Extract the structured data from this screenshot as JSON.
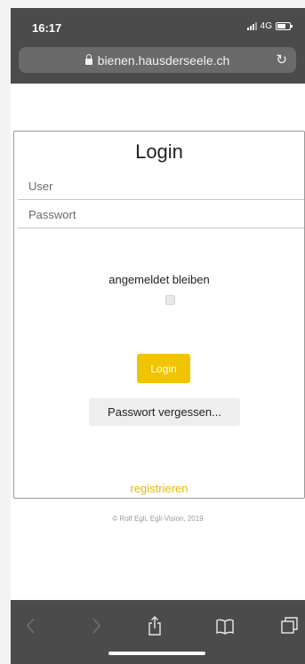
{
  "status_bar": {
    "time": "16:17",
    "network": "4G"
  },
  "browser": {
    "url": "bienen.hausderseele.ch"
  },
  "login": {
    "title": "Login",
    "user_placeholder": "User",
    "password_placeholder": "Passwort",
    "remember_label": "angemeldet bleiben",
    "remember_checked": false,
    "login_button": "Login",
    "forgot_button": "Passwort vergessen...",
    "register_link": "registrieren"
  },
  "footer": {
    "copyright": "© Rolf Egli, Egli-Vision, 2019"
  },
  "colors": {
    "accent": "#f0c400",
    "link": "#e8b800",
    "chrome": "#4b4b4b"
  },
  "toolbar_icons": [
    "back-icon",
    "forward-icon",
    "share-icon",
    "bookmarks-icon",
    "tabs-icon"
  ]
}
